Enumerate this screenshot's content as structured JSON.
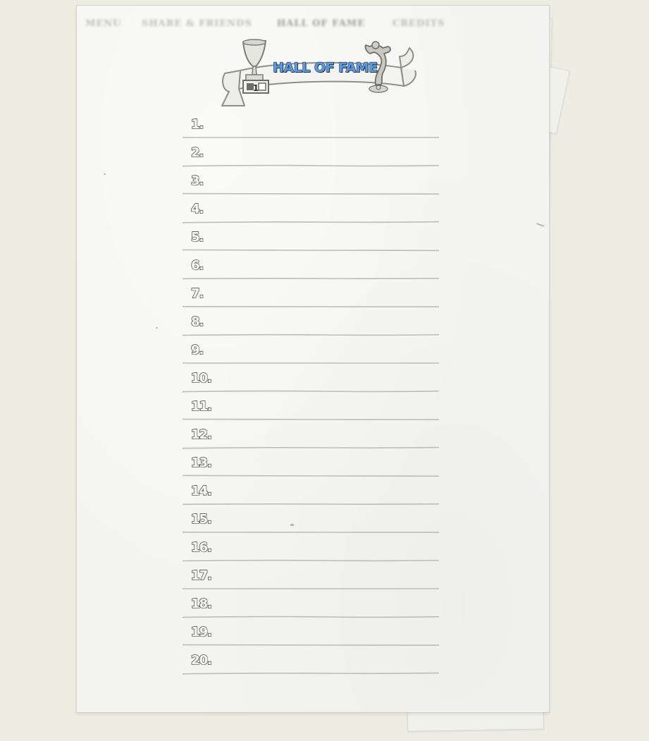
{
  "nav": {
    "tabs": [
      {
        "label": "MENU"
      },
      {
        "label": "SHARE & FRIENDS"
      },
      {
        "label": "HALL OF FAME"
      },
      {
        "label": "CREDITS"
      }
    ]
  },
  "banner": {
    "title": "HALL OF FAME",
    "trophy_plate": "1",
    "icons": [
      "trophy-cup-icon",
      "statue-icon",
      "ribbon-scroll-icon"
    ]
  },
  "rankings": [
    {
      "rank": "1.",
      "name": ""
    },
    {
      "rank": "2.",
      "name": ""
    },
    {
      "rank": "3.",
      "name": ""
    },
    {
      "rank": "4.",
      "name": ""
    },
    {
      "rank": "5.",
      "name": ""
    },
    {
      "rank": "6.",
      "name": ""
    },
    {
      "rank": "7.",
      "name": ""
    },
    {
      "rank": "8.",
      "name": ""
    },
    {
      "rank": "9.",
      "name": ""
    },
    {
      "rank": "10.",
      "name": ""
    },
    {
      "rank": "11.",
      "name": ""
    },
    {
      "rank": "12.",
      "name": ""
    },
    {
      "rank": "13.",
      "name": ""
    },
    {
      "rank": "14.",
      "name": ""
    },
    {
      "rank": "15.",
      "name": ""
    },
    {
      "rank": "16.",
      "name": ""
    },
    {
      "rank": "17.",
      "name": ""
    },
    {
      "rank": "18.",
      "name": ""
    },
    {
      "rank": "19.",
      "name": ""
    },
    {
      "rank": "20.",
      "name": ""
    }
  ],
  "colors": {
    "background": "#edede3",
    "paper": "#f4f4f1",
    "title_fill": "#5b9ae0",
    "title_outline": "#2c3d58",
    "line": "#bdbdb8"
  }
}
